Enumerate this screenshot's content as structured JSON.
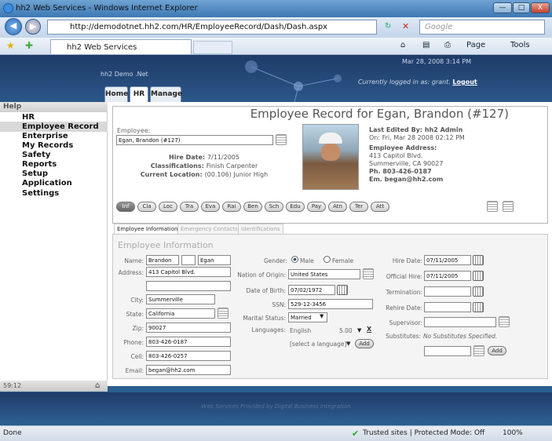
{
  "window": {
    "title": "hh2 Web Services - Windows Internet Explorer",
    "min": "—",
    "max": "□",
    "close": "X"
  },
  "browser": {
    "url": "http://demodotnet.hh2.com/HR/EmployeeRecord/Dash/Dash.aspx",
    "search_placeholder": "Google",
    "tab_title": "hh2 Web Services",
    "page_menu": "Page",
    "tools_menu": "Tools",
    "back": "◀",
    "fwd": "▶",
    "refresh": "↻",
    "stop": "✕",
    "go": "▾"
  },
  "banner": {
    "company": "hh2 Demo .Net",
    "datetime": "Mar 28, 2008 3:14 PM",
    "logged_prefix": "Currently logged in as: grant.",
    "logout": "Logout"
  },
  "topnav": [
    {
      "label": "Home"
    },
    {
      "label": "HR"
    },
    {
      "label": "Manage"
    }
  ],
  "sidebar": {
    "header": "Help",
    "items": [
      {
        "label": "HR"
      },
      {
        "label": "Employee Record"
      },
      {
        "label": "Enterprise"
      },
      {
        "label": "My Records"
      },
      {
        "label": "Safety"
      },
      {
        "label": "Reports"
      },
      {
        "label": "Setup"
      },
      {
        "label": "Application Settings"
      }
    ],
    "footer": "59:12"
  },
  "record": {
    "title": "Employee Record for Egan, Brandon (#127)",
    "employee_label": "Employee:",
    "employee_value": "Egan, Brandon (#127)",
    "hire_date_label": "Hire Date:",
    "hire_date": "7/11/2005",
    "classifications_label": "Classifications:",
    "classifications": "Finish Carpenter",
    "location_label": "Current Location:",
    "location": "(00.106) Junior High",
    "last_edited": "Last Edited By: hh2 Admin",
    "last_edited_on": "On: Fri, Mar 28 2008 02:12 PM",
    "address_label": "Employee Address:",
    "address1": "413 Capitol Blvd.",
    "address2": "Summerville, CA 90027",
    "phone": "Ph. 803-426-0187",
    "email": "Em. began@hh2.com"
  },
  "pills": [
    "Inf",
    "Cla",
    "Loc",
    "Tra",
    "Eva",
    "Rai",
    "Ben",
    "Sch",
    "Edu",
    "Pay",
    "Atn",
    "Ter",
    "Att"
  ],
  "subtabs": [
    "Employee Information",
    "Emergency Contacts",
    "Identifications"
  ],
  "form": {
    "title": "Employee Information",
    "name_label": "Name:",
    "first": "Brandon",
    "middle": "",
    "last": "Egan",
    "address_label": "Address:",
    "address": "413 Capitol Blvd.",
    "address2": "",
    "city_label": "City:",
    "city": "Summerville",
    "state_label": "State:",
    "state": "California",
    "zip_label": "Zip:",
    "zip": "90027",
    "phone_label": "Phone:",
    "phone": "803-426-0187",
    "cell_label": "Cell:",
    "cell": "803-426-0257",
    "email_label": "Email:",
    "email": "began@hh2.com",
    "gender_label": "Gender:",
    "male": "Male",
    "female": "Female",
    "nation_label": "Nation of Origin:",
    "nation": "United States",
    "dob_label": "Date of Birth:",
    "dob": "07/02/1972",
    "ssn_label": "SSN:",
    "ssn": "529-12-3456",
    "marital_label": "Marital Status:",
    "marital": "Married",
    "languages_label": "Languages:",
    "language": "English",
    "lang_level": "5.00",
    "lang_remove": "X",
    "lang_select": "[select a language]",
    "add": "Add",
    "hire_label": "Hire Date:",
    "hire": "07/11/2005",
    "official_label": "Official Hire:",
    "official": "07/11/2005",
    "termination_label": "Termination:",
    "termination": "",
    "rehire_label": "Rehire Date:",
    "rehire": "",
    "supervisor_label": "Supervisor:",
    "supervisor": "",
    "substitutes_label": "Substitutes:",
    "substitutes": "No Substitutes Specified."
  },
  "footer": {
    "text": "Web Services Provided by Digital Business Integration"
  },
  "status": {
    "left": "Done",
    "zone": "Trusted sites | Protected Mode: Off",
    "zoom": "100%"
  }
}
